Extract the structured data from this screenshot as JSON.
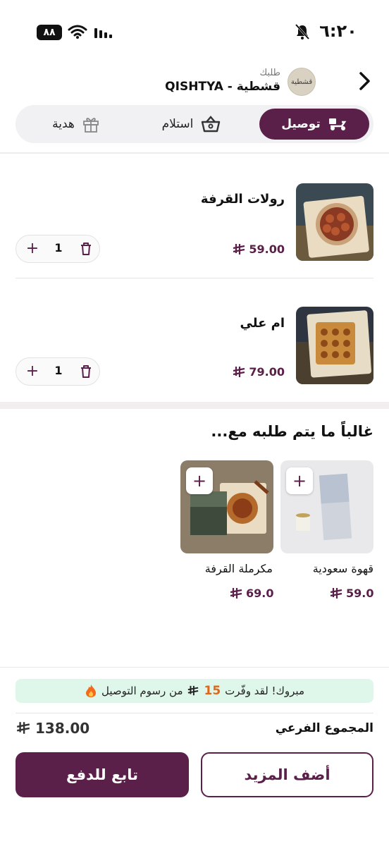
{
  "status_bar": {
    "time": "٦:٢٠",
    "battery": "٨٨"
  },
  "header": {
    "subtitle": "طلبك",
    "store_name": "قشطية - QISHTYA",
    "logo_text": "قشطية"
  },
  "tabs": [
    {
      "label": "توصيل",
      "active": true
    },
    {
      "label": "استلام",
      "active": false
    },
    {
      "label": "هدية",
      "active": false
    }
  ],
  "cart": {
    "items": [
      {
        "title": "رولات القرفة",
        "price": "59.00",
        "qty": "1"
      },
      {
        "title": "ام علي",
        "price": "79.00",
        "qty": "1"
      }
    ]
  },
  "suggestions": {
    "title": "غالباً ما يتم طلبه مع...",
    "items": [
      {
        "name": "قهوة سعودية",
        "price": "59.0"
      },
      {
        "name": "مكرملة  القرفة",
        "price": "69.0"
      }
    ]
  },
  "footer": {
    "promo_prefix": "مبروك! لقد وفّرت",
    "promo_amount": "15",
    "promo_suffix": "من رسوم التوصيل",
    "subtotal_label": "المجموع الفرعي",
    "subtotal_value": "138.00",
    "add_more": "أضف المزيد",
    "checkout": "تابع للدفع"
  },
  "colors": {
    "brand": "#5b2049",
    "promo_bg": "#dff7ea",
    "promo_accent": "#e0661a"
  }
}
